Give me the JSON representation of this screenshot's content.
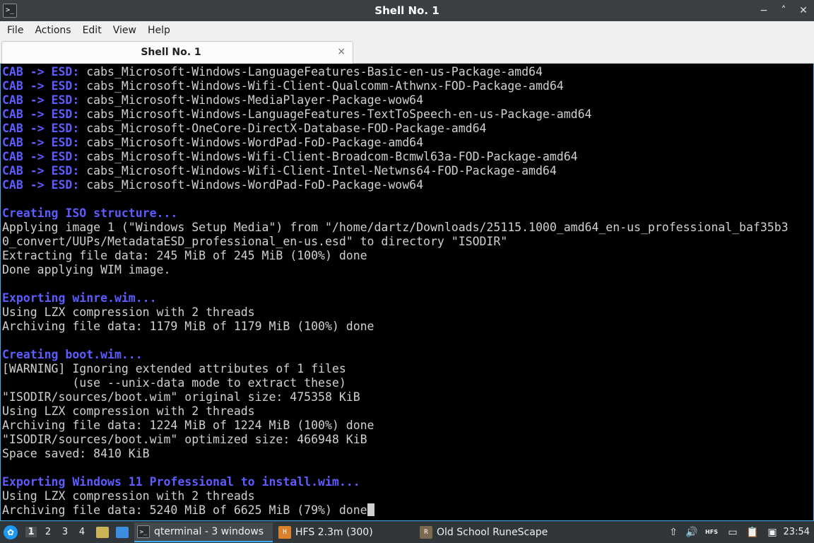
{
  "window": {
    "title": "Shell No. 1",
    "terminal_icon_glyph": ">_",
    "controls": {
      "minimize": "−",
      "maximize": "˄",
      "close": "✕"
    }
  },
  "menu": [
    "File",
    "Actions",
    "Edit",
    "View",
    "Help"
  ],
  "tab": {
    "label": "Shell No. 1",
    "close": "×"
  },
  "terminal": {
    "lines": [
      {
        "prefix": "CAB -> ESD:",
        "text": " cabs_Microsoft-Windows-LanguageFeatures-Basic-en-us-Package-amd64"
      },
      {
        "prefix": "CAB -> ESD:",
        "text": " cabs_Microsoft-Windows-Wifi-Client-Qualcomm-Athwnx-FOD-Package-amd64"
      },
      {
        "prefix": "CAB -> ESD:",
        "text": " cabs_Microsoft-Windows-MediaPlayer-Package-wow64"
      },
      {
        "prefix": "CAB -> ESD:",
        "text": " cabs_Microsoft-Windows-LanguageFeatures-TextToSpeech-en-us-Package-amd64"
      },
      {
        "prefix": "CAB -> ESD:",
        "text": " cabs_Microsoft-OneCore-DirectX-Database-FOD-Package-amd64"
      },
      {
        "prefix": "CAB -> ESD:",
        "text": " cabs_Microsoft-Windows-WordPad-FoD-Package-amd64"
      },
      {
        "prefix": "CAB -> ESD:",
        "text": " cabs_Microsoft-Windows-Wifi-Client-Broadcom-Bcmwl63a-FOD-Package-amd64"
      },
      {
        "prefix": "CAB -> ESD:",
        "text": " cabs_Microsoft-Windows-Wifi-Client-Intel-Netwns64-FOD-Package-amd64"
      },
      {
        "prefix": "CAB -> ESD:",
        "text": " cabs_Microsoft-Windows-WordPad-FoD-Package-wow64"
      },
      {
        "prefix": "",
        "text": ""
      },
      {
        "prefix": "Creating ISO structure...",
        "text": ""
      },
      {
        "prefix": "",
        "text": "Applying image 1 (\"Windows Setup Media\") from \"/home/dartz/Downloads/25115.1000_amd64_en-us_professional_baf35b3"
      },
      {
        "prefix": "",
        "text": "0_convert/UUPs/MetadataESD_professional_en-us.esd\" to directory \"ISODIR\""
      },
      {
        "prefix": "",
        "text": "Extracting file data: 245 MiB of 245 MiB (100%) done"
      },
      {
        "prefix": "",
        "text": "Done applying WIM image."
      },
      {
        "prefix": "",
        "text": ""
      },
      {
        "prefix": "Exporting winre.wim...",
        "text": ""
      },
      {
        "prefix": "",
        "text": "Using LZX compression with 2 threads"
      },
      {
        "prefix": "",
        "text": "Archiving file data: 1179 MiB of 1179 MiB (100%) done"
      },
      {
        "prefix": "",
        "text": ""
      },
      {
        "prefix": "Creating boot.wim...",
        "text": ""
      },
      {
        "prefix": "",
        "text": "[WARNING] Ignoring extended attributes of 1 files"
      },
      {
        "prefix": "",
        "text": "          (use --unix-data mode to extract these)"
      },
      {
        "prefix": "",
        "text": "\"ISODIR/sources/boot.wim\" original size: 475358 KiB"
      },
      {
        "prefix": "",
        "text": "Using LZX compression with 2 threads"
      },
      {
        "prefix": "",
        "text": "Archiving file data: 1224 MiB of 1224 MiB (100%) done"
      },
      {
        "prefix": "",
        "text": "\"ISODIR/sources/boot.wim\" optimized size: 466948 KiB"
      },
      {
        "prefix": "",
        "text": "Space saved: 8410 KiB"
      },
      {
        "prefix": "",
        "text": ""
      },
      {
        "prefix": "Exporting Windows 11 Professional to install.wim...",
        "text": ""
      },
      {
        "prefix": "",
        "text": "Using LZX compression with 2 threads"
      },
      {
        "prefix": "",
        "text": "Archiving file data: 5240 MiB of 6625 MiB (79%) done"
      }
    ]
  },
  "taskbar": {
    "start_glyph": "✿",
    "desktops": [
      "1",
      "2",
      "3",
      "4"
    ],
    "tasks": [
      {
        "label": "qterminal - 3 windows",
        "icon_glyph": ">_",
        "icon_color": "#2a2c30",
        "active": true
      },
      {
        "label": "HFS 2.3m (300)",
        "icon_glyph": "H",
        "icon_color": "#d9822b",
        "active": false
      },
      {
        "label": "Old School RuneScape",
        "icon_glyph": "R",
        "icon_color": "#7a6a4f",
        "active": false
      }
    ],
    "tray": {
      "upload_glyph": "⇧",
      "volume_glyph": "🔊",
      "hfs_glyph": "HFS",
      "network_glyph": "▭",
      "clipboard_glyph": "📋",
      "screen_glyph": "▣"
    },
    "clock": "23:54"
  },
  "colors": {
    "highlight": "#5c5cff",
    "accent": "#3daee9"
  }
}
